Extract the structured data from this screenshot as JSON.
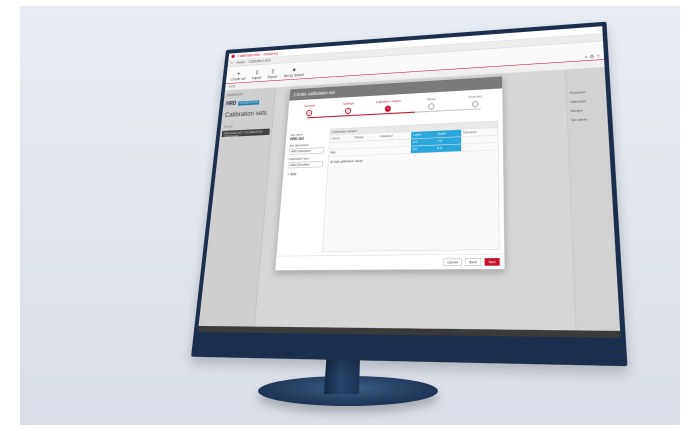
{
  "app": {
    "title": "CalibrationSet - Sartorius"
  },
  "tabs": [
    "Home",
    "Calibration sets"
  ],
  "ribbon": [
    {
      "label": "Create set",
      "icon": "plus-icon"
    },
    {
      "label": "Import",
      "icon": "import-icon"
    },
    {
      "label": "Export",
      "icon": "export-icon"
    },
    {
      "label": "Set as default",
      "icon": "pin-icon"
    }
  ],
  "subbar": "Sets",
  "left": {
    "section_label": "Instrument",
    "logo_text": "HRD",
    "logo_chip": "CALIBRATION",
    "heading": "Calibration sets",
    "small_label": "All sets",
    "item": "HRD-Multi-SET CALIBRATION STANDARD"
  },
  "right": {
    "items": [
      "Properties",
      "Standards",
      "Ranges",
      "Set values"
    ]
  },
  "dialog": {
    "title": "Create calibration set",
    "steps": [
      "General",
      "Settings",
      "Calibration ranges",
      "Values",
      "Summary"
    ],
    "form": {
      "name_label": "Set name",
      "name_value": "HRD-Set",
      "field1_label": "Set description",
      "field1_value": "HRD-Standard",
      "field2_label": "Calibration type",
      "field2_value": "HRD-Standard",
      "add_label": "Add"
    },
    "table": {
      "title": "Calibration ranges",
      "headers": [
        "Name",
        "Range",
        "Standard",
        "Lower",
        "Upper",
        "Tolerance"
      ],
      "rows": [
        [
          "",
          "",
          "",
          "2.0",
          "4.0",
          ""
        ],
        [
          "Mid",
          "",
          "",
          "4.0",
          "6.0",
          ""
        ]
      ],
      "add_range": "Add calibration range"
    },
    "buttons": {
      "cancel": "Cancel",
      "back": "Back",
      "next": "Next"
    }
  }
}
